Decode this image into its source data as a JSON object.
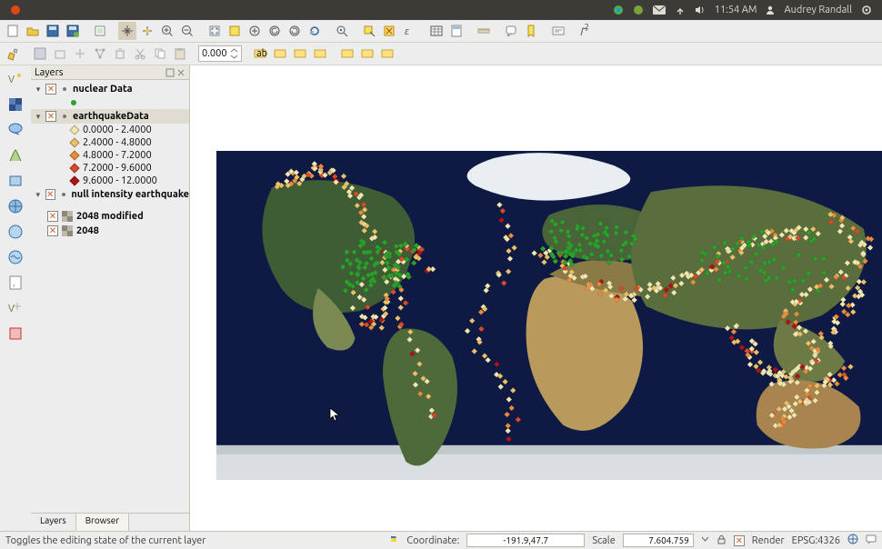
{
  "menubar": {
    "time": "11:54 AM",
    "user": "Audrey Randall"
  },
  "panel": {
    "title": "Layers"
  },
  "layers": {
    "nodes": [
      {
        "name": "nuclear Data",
        "checked": true,
        "expanded": true,
        "legend": [
          {
            "kind": "dot",
            "color": "#2ca02c",
            "label": ""
          }
        ]
      },
      {
        "name": "earthquakeData",
        "checked": true,
        "expanded": true,
        "legend": [
          {
            "kind": "diamond",
            "color": "#f3e7b1",
            "label": "0.0000 - 2.4000"
          },
          {
            "kind": "diamond",
            "color": "#eac069",
            "label": "2.4000 - 4.8000"
          },
          {
            "kind": "diamond",
            "color": "#e88b3a",
            "label": "4.8000 - 7.2000"
          },
          {
            "kind": "diamond",
            "color": "#d84b2a",
            "label": "7.2000 - 9.6000"
          },
          {
            "kind": "diamond",
            "color": "#b11313",
            "label": "9.6000 - 12.0000"
          }
        ]
      },
      {
        "name": "null intensity earthquake",
        "checked": true,
        "expanded": true,
        "legend": []
      }
    ],
    "rasters": [
      {
        "name": "2048 modified",
        "checked": true
      },
      {
        "name": "2048",
        "checked": true
      }
    ]
  },
  "tabs": {
    "layers": "Layers",
    "browser": "Browser"
  },
  "status": {
    "hint": "Toggles the editing state of the current layer",
    "coord_label": "Coordinate:",
    "coord_value": "-191.9,47.7",
    "scale_label": "Scale",
    "scale_value": "7.604.759",
    "render_label": "Render",
    "crs": "EPSG:4326"
  },
  "spinbox": {
    "value": "0.000"
  }
}
